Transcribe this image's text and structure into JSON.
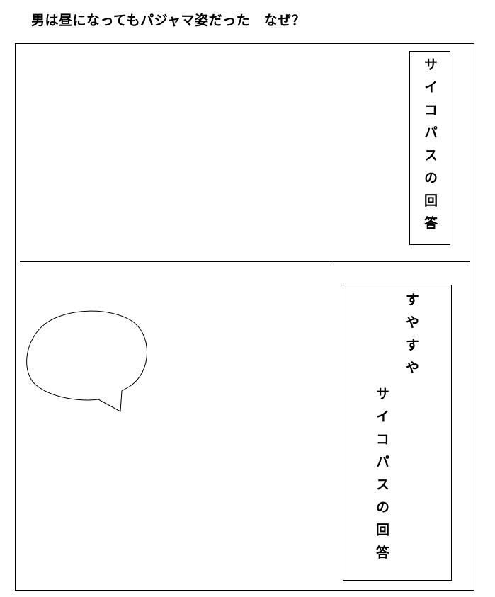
{
  "header": {
    "question": "男は昼になってもパジャマ姿だった　なぜ？"
  },
  "panel_top": {
    "caption": "サイコパスの回答"
  },
  "panel_bottom": {
    "line1": "すやすや",
    "caption": "サイコパスの回答"
  }
}
